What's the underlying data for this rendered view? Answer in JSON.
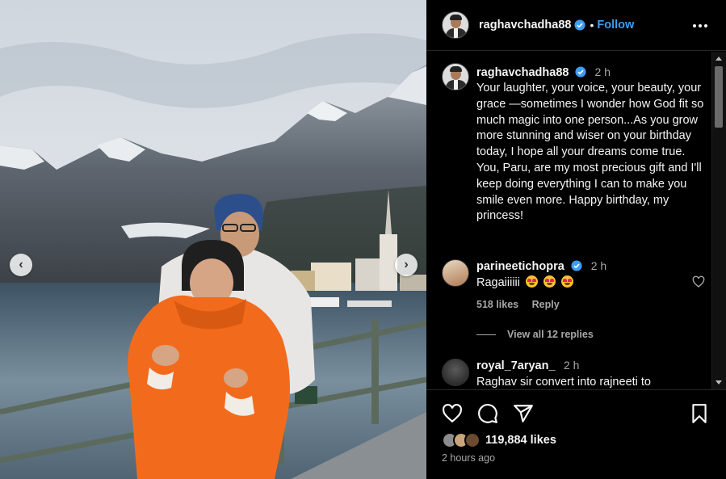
{
  "post": {
    "author": "raghavchadha88",
    "follow_label": "Follow",
    "more_options": "more-options",
    "photo_alt": "Couple posing by a lake with snowy mountains",
    "caption": {
      "username": "raghavchadha88",
      "time": "2 h",
      "text": "Your laughter, your voice, your beauty, your grace —sometimes I wonder how God fit so much magic into one person...As you grow more stunning and wiser on your birthday today, I hope all your dreams come true. You, Paru, are my most precious gift and I'll keep doing everything I can to make you smile even more. Happy birthday, my princess!"
    },
    "comments": [
      {
        "username": "parineetichopra",
        "verified": true,
        "time": "2 h",
        "text": "Ragaiiiiii",
        "likes": "518 likes",
        "reply": "Reply"
      },
      {
        "username": "royal_7aryan_",
        "verified": false,
        "time": "2 h",
        "text": "Raghav sir convert into rajneeti to"
      }
    ],
    "view_replies": "View all 12 replies",
    "likes_count": "119,884 likes",
    "posted_time": "2 hours ago"
  },
  "colors": {
    "background": "#000000",
    "link_blue": "#3e9df2",
    "muted_text": "#a8a8a8",
    "divider": "#262626",
    "jacket_orange": "#f26b1d"
  },
  "icons": [
    "chevron-left-icon",
    "chevron-right-icon",
    "verified-icon",
    "more-icon",
    "heart-icon",
    "comment-icon",
    "share-icon",
    "bookmark-icon"
  ]
}
